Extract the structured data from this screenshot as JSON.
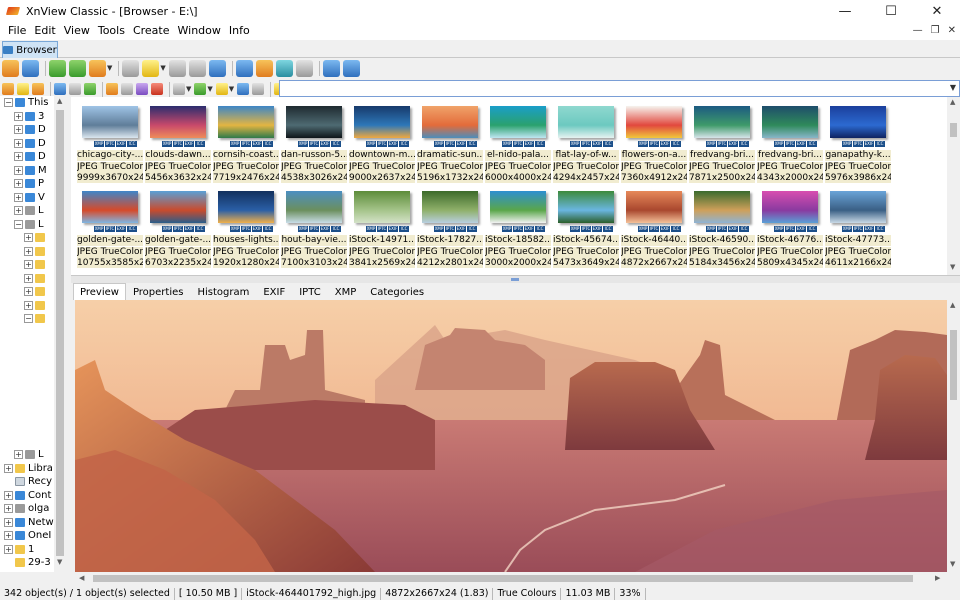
{
  "window": {
    "title": "XnView Classic - [Browser - E:\\]",
    "controls": [
      "—",
      "☐",
      "✕"
    ],
    "mdi_controls": [
      "—",
      "❐",
      "✕"
    ]
  },
  "menu": [
    "File",
    "Edit",
    "View",
    "Tools",
    "Create",
    "Window",
    "Info"
  ],
  "doc_tab": "Browser",
  "tree": {
    "items": [
      {
        "label": "This",
        "indent": 1,
        "exp": "−",
        "icon": "t-drive"
      },
      {
        "label": "3",
        "indent": 2,
        "exp": "+",
        "icon": "t-drive"
      },
      {
        "label": "D",
        "indent": 2,
        "exp": "+",
        "icon": "t-drive"
      },
      {
        "label": "D",
        "indent": 2,
        "exp": "+",
        "icon": "t-drive"
      },
      {
        "label": "D",
        "indent": 2,
        "exp": "+",
        "icon": "t-drive"
      },
      {
        "label": "M",
        "indent": 2,
        "exp": "+",
        "icon": "t-drive"
      },
      {
        "label": "P",
        "indent": 2,
        "exp": "+",
        "icon": "t-drive"
      },
      {
        "label": "V",
        "indent": 2,
        "exp": "+",
        "icon": "t-drive"
      },
      {
        "label": "L",
        "indent": 2,
        "exp": "+",
        "icon": "t-gray"
      },
      {
        "label": "L",
        "indent": 2,
        "exp": "−",
        "icon": "t-gray"
      },
      {
        "label": "",
        "indent": 3,
        "exp": "+",
        "icon": "t-folder"
      },
      {
        "label": "",
        "indent": 3,
        "exp": "+",
        "icon": "t-folder"
      },
      {
        "label": "",
        "indent": 3,
        "exp": "+",
        "icon": "t-folder"
      },
      {
        "label": "",
        "indent": 3,
        "exp": "+",
        "icon": "t-folder"
      },
      {
        "label": "",
        "indent": 3,
        "exp": "+",
        "icon": "t-folder"
      },
      {
        "label": "",
        "indent": 3,
        "exp": "+",
        "icon": "t-folder"
      },
      {
        "label": "",
        "indent": 3,
        "exp": "−",
        "icon": "t-folder"
      }
    ],
    "bottom_items": [
      {
        "label": "L",
        "indent": 2,
        "exp": "+",
        "icon": "t-gray"
      },
      {
        "label": "Libra",
        "indent": 1,
        "exp": "+",
        "icon": "t-folder"
      },
      {
        "label": "Recy",
        "indent": 1,
        "exp": "",
        "icon": "t-bin"
      },
      {
        "label": "Cont",
        "indent": 1,
        "exp": "+",
        "icon": "t-drive"
      },
      {
        "label": "olga",
        "indent": 1,
        "exp": "+",
        "icon": "t-gray"
      },
      {
        "label": "Netw",
        "indent": 1,
        "exp": "+",
        "icon": "t-drive"
      },
      {
        "label": "OneI",
        "indent": 1,
        "exp": "+",
        "icon": "t-drive"
      },
      {
        "label": "1",
        "indent": 1,
        "exp": "+",
        "icon": "t-folder"
      },
      {
        "label": "29-3",
        "indent": 1,
        "exp": "",
        "icon": "t-folder"
      }
    ]
  },
  "thumbnails": [
    {
      "name": "chicago-city-...",
      "type": "JPEG TrueColor...",
      "dims": "9999x3670x24",
      "colors": [
        "#9fc4e6",
        "#5f7d99",
        "#dbe6ef"
      ]
    },
    {
      "name": "clouds-dawn...",
      "type": "JPEG TrueColor...",
      "dims": "5456x3632x24",
      "colors": [
        "#2b2d6e",
        "#c8496b",
        "#ef8c5a"
      ]
    },
    {
      "name": "cornsih-coast...",
      "type": "JPEG TrueColor...",
      "dims": "7719x2476x24",
      "colors": [
        "#3d86c6",
        "#e3b542",
        "#2f7a4a"
      ]
    },
    {
      "name": "dan-russon-5...",
      "type": "JPEG TrueColor...",
      "dims": "4538x3026x24",
      "colors": [
        "#1f2a30",
        "#4e6a72",
        "#0f1519"
      ]
    },
    {
      "name": "downtown-m...",
      "type": "JPEG TrueColor...",
      "dims": "9000x2637x24",
      "colors": [
        "#173a6b",
        "#2d77b8",
        "#f0a940"
      ]
    },
    {
      "name": "dramatic-sun...",
      "type": "JPEG TrueColor...",
      "dims": "5196x1732x24",
      "colors": [
        "#f0a36a",
        "#e36b3a",
        "#4c8dbb"
      ]
    },
    {
      "name": "el-nido-pala...",
      "type": "JPEG TrueColor...",
      "dims": "6000x4000x24",
      "colors": [
        "#1a9ec9",
        "#2aa16e",
        "#bfe6f2"
      ]
    },
    {
      "name": "flat-lay-of-w...",
      "type": "JPEG TrueColor...",
      "dims": "4294x2457x24",
      "colors": [
        "#8fd8cf",
        "#6cc9c0",
        "#e6f3f1"
      ]
    },
    {
      "name": "flowers-on-a...",
      "type": "JPEG TrueColor...",
      "dims": "7360x4912x24",
      "colors": [
        "#f6f3ee",
        "#e1483e",
        "#f1c83c"
      ]
    },
    {
      "name": "fredvang-bri...",
      "type": "JPEG TrueColor...",
      "dims": "7871x2500x24",
      "colors": [
        "#1c5a82",
        "#3e9a6a",
        "#d7e4ea"
      ]
    },
    {
      "name": "fredvang-bri...",
      "type": "JPEG TrueColor...",
      "dims": "4343x2000x24",
      "colors": [
        "#1e4d6b",
        "#2f8a5b",
        "#89b6c9"
      ]
    },
    {
      "name": "ganapathy-k...",
      "type": "JPEG TrueColor...",
      "dims": "5976x3986x24",
      "colors": [
        "#1b3f9c",
        "#2c6ad1",
        "#0e2361"
      ]
    },
    {
      "name": "golden-gate-...",
      "type": "JPEG TrueColor...",
      "dims": "10755x3585x24",
      "colors": [
        "#3f86c9",
        "#d64a2a",
        "#7fb6e3"
      ]
    },
    {
      "name": "golden-gate-...",
      "type": "JPEG TrueColor...",
      "dims": "6703x2235x24",
      "colors": [
        "#5aa0d6",
        "#c94b2d",
        "#2a5d8a"
      ]
    },
    {
      "name": "houses-lights...",
      "type": "JPEG TrueColor...",
      "dims": "1920x1280x24",
      "colors": [
        "#12305d",
        "#2a5fa6",
        "#f0b04a"
      ]
    },
    {
      "name": "hout-bay-vie...",
      "type": "JPEG TrueColor...",
      "dims": "7100x3103x24",
      "colors": [
        "#4c8fc2",
        "#6b8f5e",
        "#c9dde8"
      ]
    },
    {
      "name": "iStock-14971...",
      "type": "JPEG TrueColor...",
      "dims": "3841x2569x24",
      "colors": [
        "#5d8c3a",
        "#a5c48a",
        "#d4e2c8"
      ]
    },
    {
      "name": "iStock-17827...",
      "type": "JPEG TrueColor...",
      "dims": "4212x2801x24",
      "colors": [
        "#3c6a2a",
        "#8fb06a",
        "#b9cfe0"
      ]
    },
    {
      "name": "iStock-18582...",
      "type": "JPEG TrueColor...",
      "dims": "3000x2000x24",
      "colors": [
        "#2e8fd0",
        "#5aa64a",
        "#f2f2f2"
      ]
    },
    {
      "name": "iStock-45674...",
      "type": "JPEG TrueColor...",
      "dims": "5473x3649x24",
      "colors": [
        "#3d8a3c",
        "#6ab6e0",
        "#2b5e2a"
      ]
    },
    {
      "name": "iStock-46440...",
      "type": "JPEG TrueColor...",
      "dims": "4872x2667x24",
      "colors": [
        "#e6895a",
        "#a9472e",
        "#f4c199"
      ]
    },
    {
      "name": "iStock-46590...",
      "type": "JPEG TrueColor...",
      "dims": "5184x3456x24",
      "colors": [
        "#3a6b2e",
        "#cfa05a",
        "#8fb3d4"
      ]
    },
    {
      "name": "iStock-46776...",
      "type": "JPEG TrueColor...",
      "dims": "5809x4345x24",
      "colors": [
        "#d84fb0",
        "#8a3aa0",
        "#5aa0d6"
      ]
    },
    {
      "name": "iStock-47773...",
      "type": "JPEG TrueColor...",
      "dims": "4611x2166x24",
      "colors": [
        "#6aa4d8",
        "#3a5f85",
        "#c9d9e6"
      ]
    }
  ],
  "badges": [
    "XMP",
    "IPTC",
    "EXIF",
    "ICC"
  ],
  "preview_tabs": [
    "Preview",
    "Properties",
    "Histogram",
    "EXIF",
    "IPTC",
    "XMP",
    "Categories"
  ],
  "preview_active_tab": "Preview",
  "status": [
    "342 object(s) / 1 object(s) selected",
    "[ 10.50 MB ]",
    "iStock-464401792_high.jpg",
    "4872x2667x24 (1.83)",
    "True Colours",
    "11.03 MB",
    "33%"
  ]
}
